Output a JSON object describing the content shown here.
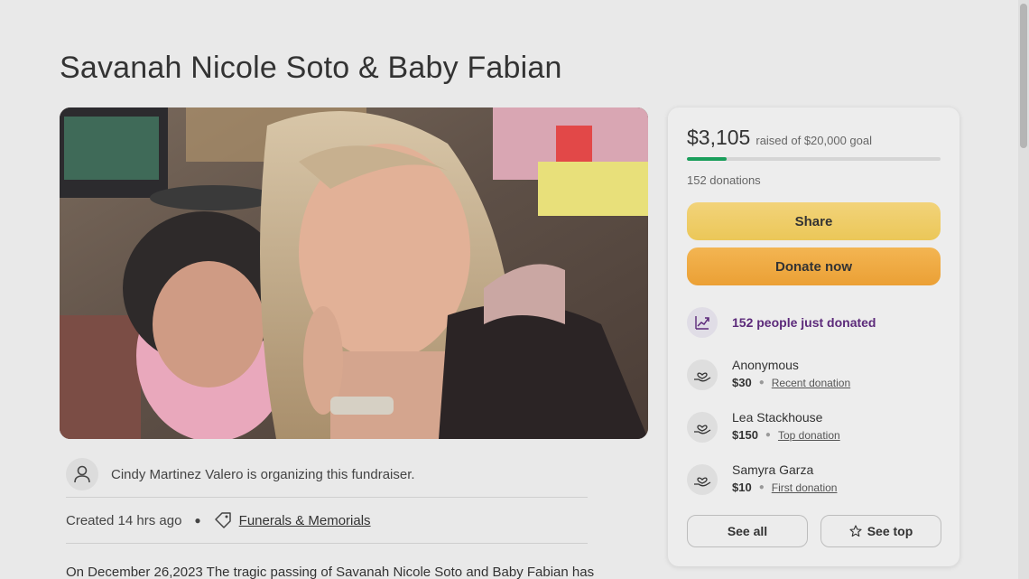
{
  "page": {
    "title": "Savanah Nicole Soto & Baby Fabian"
  },
  "organizer": {
    "text": "Cindy Martinez Valero is organizing this fundraiser."
  },
  "meta": {
    "created": "Created 14 hrs ago",
    "category": "Funerals & Memorials"
  },
  "story": {
    "excerpt": "On December 26,2023 The tragic passing of Savanah Nicole Soto and Baby Fabian has"
  },
  "donation_card": {
    "raised_amount": "$3,105",
    "raised_goal": "raised of $20,000 goal",
    "progress_fraction": 0.155,
    "donation_count": "152 donations",
    "share_label": "Share",
    "donate_label": "Donate now",
    "recent_banner": "152 people just donated",
    "donors": [
      {
        "name": "Anonymous",
        "amount": "$30",
        "type": "Recent donation"
      },
      {
        "name": "Lea Stackhouse",
        "amount": "$150",
        "type": "Top donation"
      },
      {
        "name": "Samyra Garza",
        "amount": "$10",
        "type": "First donation"
      }
    ],
    "see_all_label": "See all",
    "see_top_label": "See top"
  },
  "colors": {
    "progress": "#1a9e5b",
    "share": "#ebc758",
    "donate": "#eba035",
    "banner_text": "#5c2a7a"
  },
  "icons": {
    "organizer": "person-icon",
    "category": "tag-icon",
    "banner": "trending-up-icon",
    "donor": "heart-hand-icon",
    "see_top": "star-icon"
  }
}
